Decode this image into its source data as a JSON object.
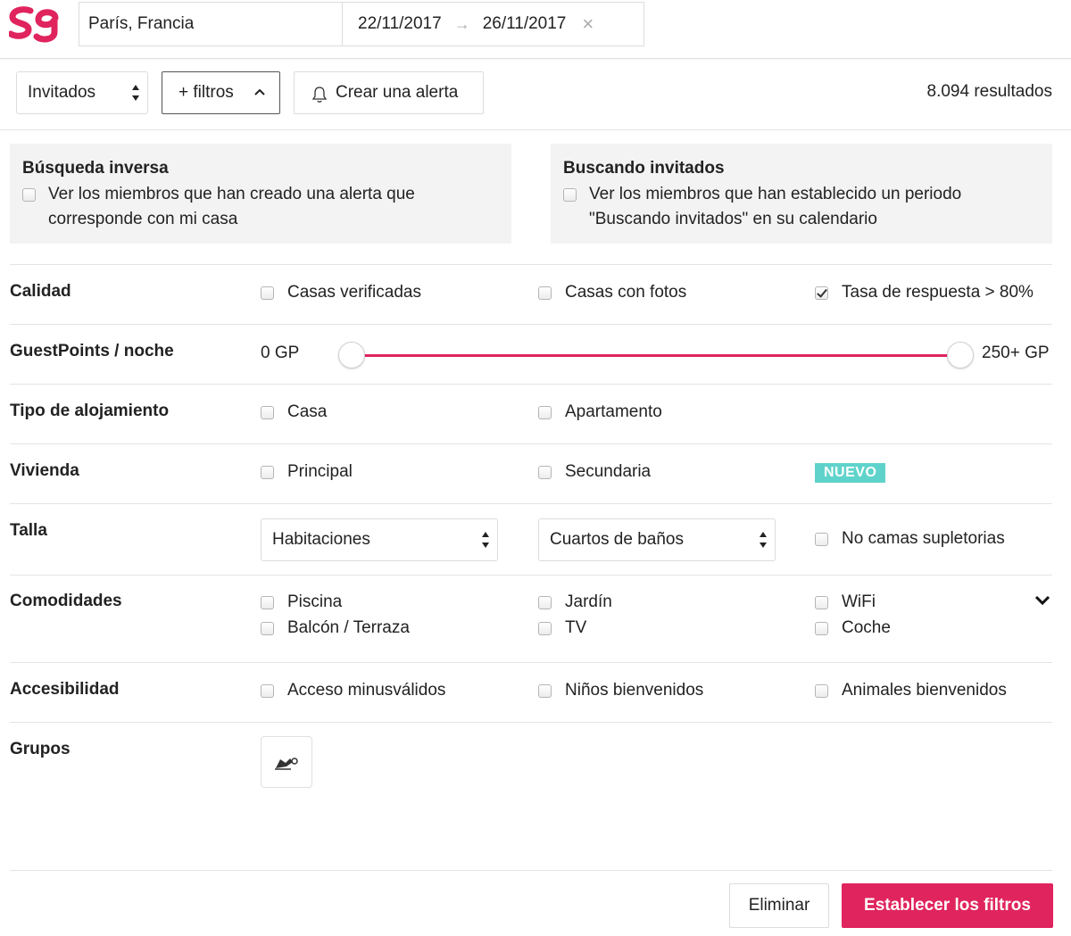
{
  "brand": {
    "accent": "#e0245e",
    "badge_color": "#5fd3cb"
  },
  "search": {
    "location": "París, Francia",
    "date_from": "22/11/2017",
    "date_arrow": "→",
    "date_to": "26/11/2017",
    "clear": "×"
  },
  "toolbar": {
    "guests_select": "Invitados",
    "filters_button": "+ filtros",
    "alert_button": "Crear una alerta",
    "results": "8.094 resultados"
  },
  "panels": {
    "reverse": {
      "title": "Búsqueda inversa",
      "text": "Ver los miembros que han creado una alerta que corresponde con mi casa"
    },
    "seeking": {
      "title": "Buscando invitados",
      "text": "Ver los miembros que han establecido un periodo \"Buscando invitados\" en su calendario"
    }
  },
  "filters": {
    "quality": {
      "label": "Calidad",
      "options": [
        {
          "label": "Casas verificadas",
          "checked": false
        },
        {
          "label": "Casas con fotos",
          "checked": false
        },
        {
          "label": "Tasa de respuesta > 80%",
          "checked": true
        }
      ]
    },
    "guestpoints": {
      "label": "GuestPoints / noche",
      "min_label": "0 GP",
      "max_label": "250+ GP",
      "range_min_fraction": 0,
      "range_max_fraction": 1
    },
    "accommodation": {
      "label": "Tipo de alojamiento",
      "options": [
        {
          "label": "Casa",
          "checked": false
        },
        {
          "label": "Apartamento",
          "checked": false
        }
      ]
    },
    "residence": {
      "label": "Vivienda",
      "options": [
        {
          "label": "Principal",
          "checked": false
        },
        {
          "label": "Secundaria",
          "checked": false
        }
      ],
      "badge": "NUEVO"
    },
    "size": {
      "label": "Talla",
      "rooms_select": "Habitaciones",
      "bathrooms_select": "Cuartos de baños",
      "no_extra_beds": "No camas supletorias"
    },
    "amenities": {
      "label": "Comodidades",
      "options": [
        {
          "label": "Piscina",
          "checked": false
        },
        {
          "label": "Jardín",
          "checked": false
        },
        {
          "label": "WiFi",
          "checked": false
        },
        {
          "label": "Balcón / Terraza",
          "checked": false
        },
        {
          "label": "TV",
          "checked": false
        },
        {
          "label": "Coche",
          "checked": false
        }
      ]
    },
    "accessibility": {
      "label": "Accesibilidad",
      "options": [
        {
          "label": "Acceso minusválidos",
          "checked": false
        },
        {
          "label": "Niños bienvenidos",
          "checked": false
        },
        {
          "label": "Animales bienvenidos",
          "checked": false
        }
      ]
    },
    "groups": {
      "label": "Grupos"
    }
  },
  "footer": {
    "delete_button": "Eliminar",
    "apply_button": "Establecer los filtros"
  }
}
